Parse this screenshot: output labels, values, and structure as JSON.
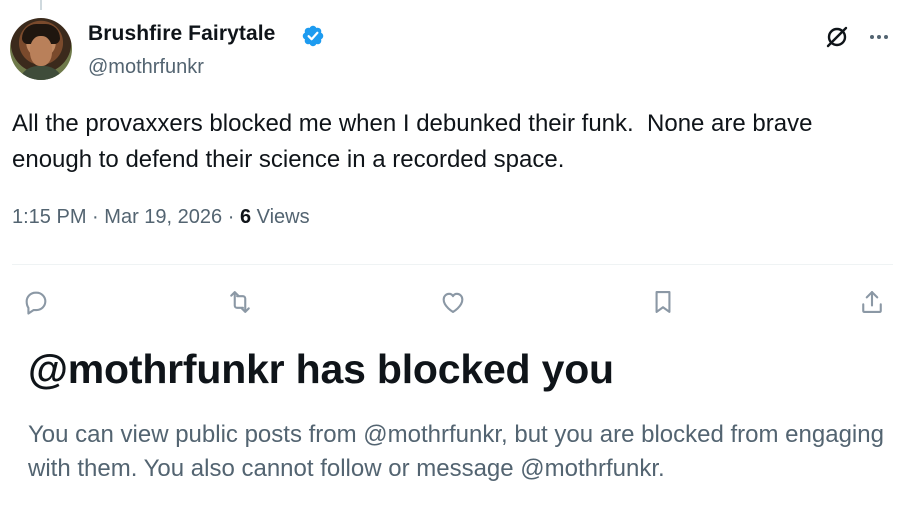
{
  "author": {
    "name": "Brushfire Fairytale",
    "handle": "@mothrfunkr",
    "verified": true,
    "verified_color": "#1d9bf0"
  },
  "tweet": {
    "text": "All the provaxxers blocked me when I debunked their funk.  None are brave enough to defend their science in a recorded space.",
    "time": "1:15 PM",
    "date": "Mar 19, 2026",
    "separator": "·",
    "views_count": "6",
    "views_label": "Views"
  },
  "actions": {
    "reply": "reply-icon",
    "repost": "repost-icon",
    "like": "heart-icon",
    "bookmark": "bookmark-icon",
    "share": "share-icon"
  },
  "blocked_notice": {
    "title": "@mothrfunkr has blocked you",
    "body": "You can view public posts from @mothrfunkr, but you are blocked from engaging with them. You also cannot follow or message @mothrfunkr."
  },
  "colors": {
    "text_primary": "#0f1419",
    "text_secondary": "#536471",
    "icon_gray": "#8b98a5",
    "divider": "#eff3f4"
  }
}
